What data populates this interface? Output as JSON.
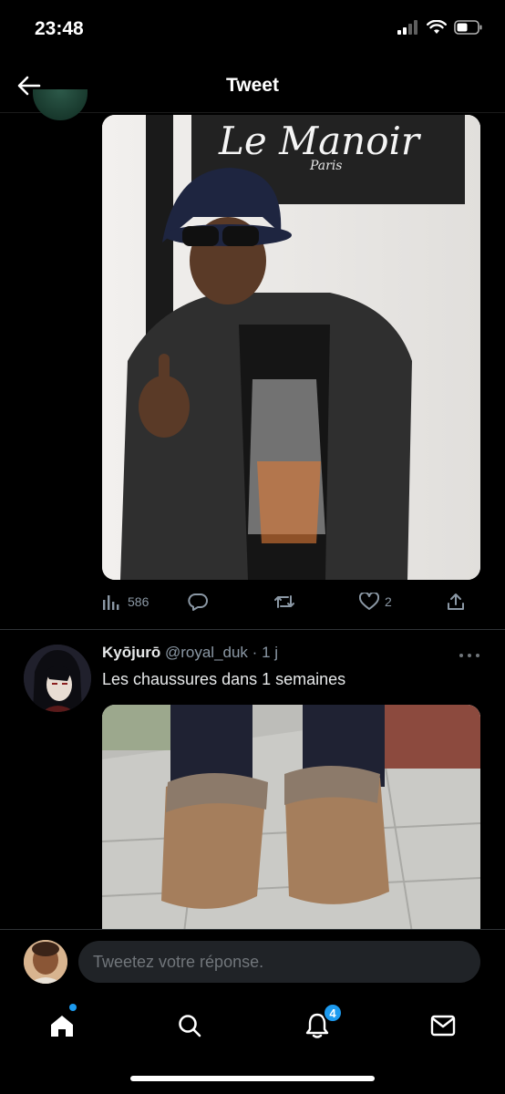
{
  "status_bar": {
    "time": "23:48"
  },
  "header": {
    "title": "Tweet"
  },
  "tweet_media": {
    "sign_text": "Le Manoir",
    "sign_subtext": "Paris"
  },
  "tweet_actions": {
    "views_count": "586",
    "likes_count": "2"
  },
  "reply_tweet": {
    "display_name": "Kyōjurō",
    "handle": "@royal_duk",
    "separator": "·",
    "time_ago": "1 j",
    "text": "Les chaussures dans 1 semaines"
  },
  "compose": {
    "placeholder": "Tweetez votre réponse."
  },
  "tabbar": {
    "notifications_badge": "4",
    "tabs": [
      "home-icon",
      "search-icon",
      "notifications-icon",
      "messages-icon"
    ]
  },
  "colors": {
    "background": "#000000",
    "accent": "#1d9bf0",
    "muted_text": "#8b98a5",
    "input_bg": "#202327"
  }
}
